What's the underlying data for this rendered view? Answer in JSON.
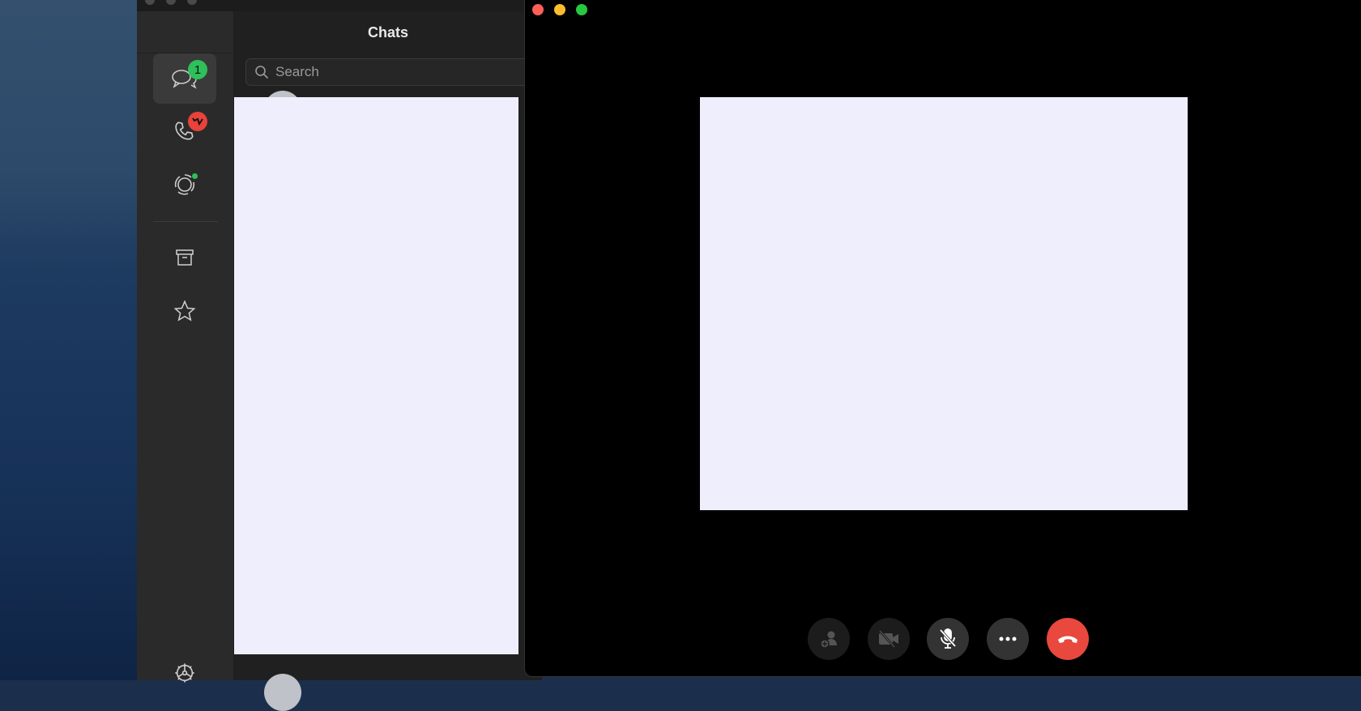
{
  "chat_list": {
    "title": "Chats",
    "search_placeholder": "Search"
  },
  "sidebar": {
    "items": [
      {
        "name": "chats",
        "badge": "1",
        "badge_color": "#2ec05a"
      },
      {
        "name": "calls",
        "badge_color": "#e8423a"
      },
      {
        "name": "status"
      },
      {
        "name": "archived"
      },
      {
        "name": "starred"
      },
      {
        "name": "settings"
      }
    ]
  },
  "call_controls": [
    "add-participant",
    "camera-off",
    "mute",
    "more",
    "end-call"
  ],
  "colors": {
    "end_call": "#e8483d",
    "traffic_close": "#fe5f57",
    "traffic_min": "#febc2e",
    "traffic_max": "#28c840"
  }
}
